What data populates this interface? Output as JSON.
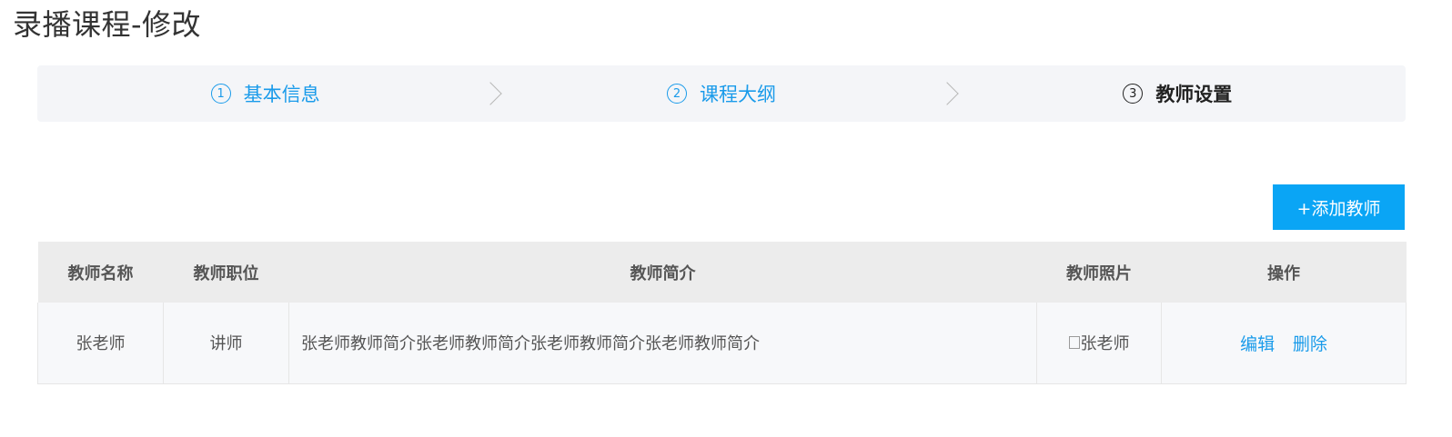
{
  "page": {
    "title": "录播课程-修改"
  },
  "steps": [
    {
      "num": "1",
      "label": "基本信息",
      "state": "done"
    },
    {
      "num": "2",
      "label": "课程大纲",
      "state": "done"
    },
    {
      "num": "3",
      "label": "教师设置",
      "state": "active"
    }
  ],
  "toolbar": {
    "add_teacher_label": "+添加教师"
  },
  "table": {
    "headers": [
      "教师名称",
      "教师职位",
      "教师简介",
      "教师照片",
      "操作"
    ],
    "rows": [
      {
        "name": "张老师",
        "position": "讲师",
        "intro": "张老师教师简介张老师教师简介张老师教师简介张老师教师简介",
        "photo_alt": "张老师",
        "edit_label": "编辑",
        "delete_label": "删除"
      }
    ]
  },
  "colors": {
    "accent": "#1a9bea",
    "button": "#0aa5f5",
    "header_bg": "#ececec",
    "steps_bg": "#f4f5f8"
  }
}
